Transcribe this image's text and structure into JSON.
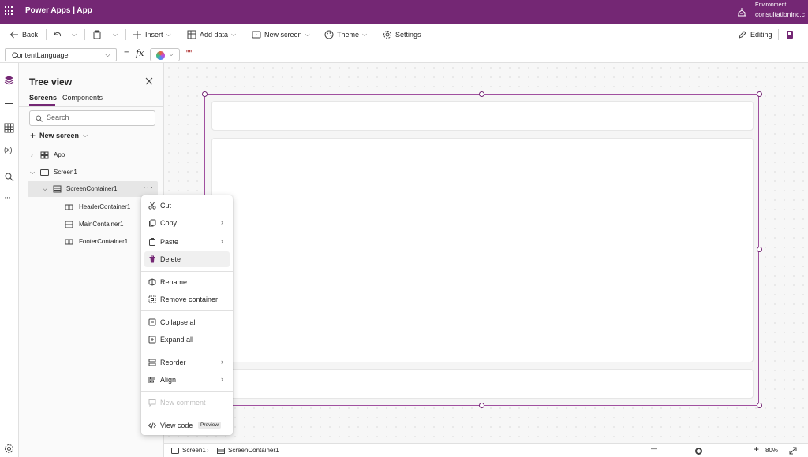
{
  "app": {
    "title": "Power Apps  |  App",
    "environment_label": "Environment",
    "environment_value": "consultationinc.c"
  },
  "commands": {
    "back": "Back",
    "insert": "Insert",
    "add_data": "Add data",
    "new_screen": "New screen",
    "theme": "Theme",
    "settings": "Settings",
    "more": "···",
    "editing": "Editing"
  },
  "formula": {
    "property": "ContentLanguage",
    "equals": "=",
    "fx": "fx",
    "value": "\"\""
  },
  "tree": {
    "title": "Tree view",
    "tabs": [
      "Screens",
      "Components"
    ],
    "search_placeholder": "Search",
    "new_screen": "New screen",
    "items": [
      {
        "label": "App"
      },
      {
        "label": "Screen1"
      },
      {
        "label": "ScreenContainer1"
      },
      {
        "label": "HeaderContainer1"
      },
      {
        "label": "MainContainer1"
      },
      {
        "label": "FooterContainer1"
      }
    ],
    "more": "···"
  },
  "context_menu": {
    "items": [
      {
        "label": "Cut",
        "icon": "scissors-icon"
      },
      {
        "label": "Copy",
        "icon": "copy-icon"
      },
      {
        "label": "Paste",
        "icon": "paste-icon"
      },
      {
        "label": "Delete",
        "icon": "trash-icon"
      },
      {
        "label": "Rename",
        "icon": "rename-icon"
      },
      {
        "label": "Remove container",
        "icon": "remove-container-icon"
      },
      {
        "label": "Collapse all",
        "icon": "collapse-icon"
      },
      {
        "label": "Expand all",
        "icon": "expand-icon"
      },
      {
        "label": "Reorder",
        "icon": "reorder-icon"
      },
      {
        "label": "Align",
        "icon": "align-icon"
      },
      {
        "label": "New comment",
        "icon": "comment-icon",
        "disabled": true
      },
      {
        "label": "View code",
        "icon": "code-icon",
        "badge": "Preview"
      }
    ],
    "hovered": "Delete"
  },
  "status": {
    "breadcrumb": [
      "Screen1",
      "ScreenContainer1"
    ],
    "zoom": "80%",
    "zoom_level": 0.5,
    "minus": "—",
    "plus": "+"
  },
  "colors": {
    "brand": "#742774",
    "selection": "#a0509f"
  }
}
